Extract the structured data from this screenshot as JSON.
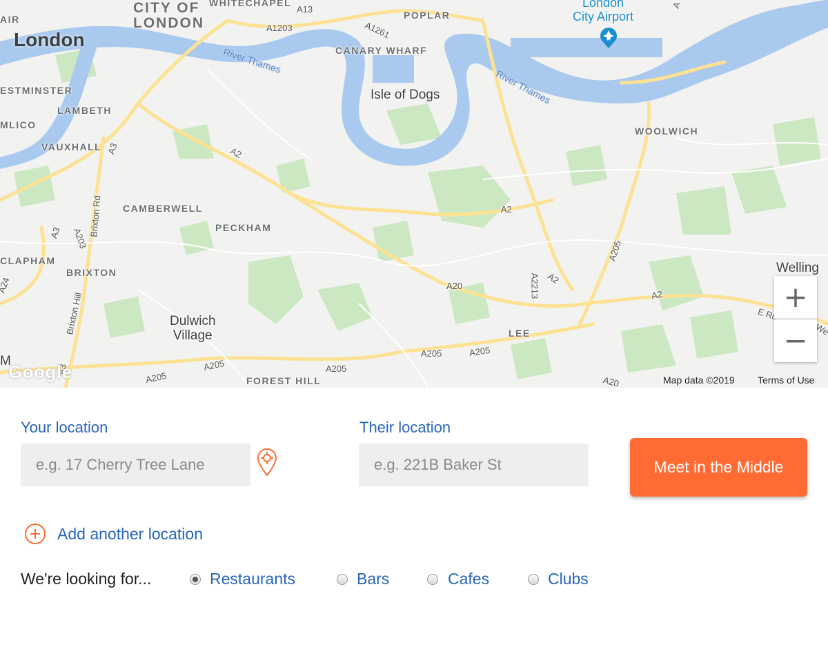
{
  "map": {
    "labels": {
      "city_of_london": "CITY OF\nLONDON",
      "london": "London",
      "whitechapel": "WHITECHAPEL",
      "poplar": "POPLAR",
      "canary_wharf": "CANARY WHARF",
      "isle_of_dogs": "Isle of Dogs",
      "airport": "London\nCity Airport",
      "westminster": "ESTMINSTER",
      "lambeth": "LAMBETH",
      "kennington": "MLICO",
      "vauxhall": "VAUXHALL",
      "air": "AIR",
      "camberwell": "CAMBERWELL",
      "peckham": "PECKHAM",
      "clapham": "CLAPHAM",
      "brixton": "BRIXTON",
      "dulwich": "Dulwich\nVillage",
      "lee": "LEE",
      "forest_hill": "FOREST HILL",
      "woolwich": "WOOLWICH",
      "welling": "Welling",
      "m": "M"
    },
    "roads": {
      "a13": "A13",
      "a1203": "A1203",
      "a1261": "A1261",
      "a2_west": "A2",
      "a3": "A3",
      "a3_south": "A3",
      "a203": "A203",
      "brixton_rd": "Brixton Rd",
      "brixton_hill": "Brixton Hill",
      "a2_center": "A2",
      "a20": "A20",
      "a2213": "A2213",
      "a2_south": "A2",
      "a2_east": "A2",
      "a205_east": "A205",
      "a205_s1": "A205",
      "a205_s2": "A205",
      "a205_s3": "A205",
      "a205_s4": "A205",
      "a205_s5": "A205",
      "a24": "A24",
      "a20_edge": "A20",
      "e_rd": "E Ro",
      "we": "We",
      "a_top": "A",
      "a3_bottom": "A3"
    },
    "rivers": {
      "thames_west": "River Thames",
      "thames_east": "River Thames"
    },
    "zoom_in": "+",
    "zoom_out": "−",
    "attribution": "Map data ©2019",
    "terms": "Terms of Use",
    "logo": "Google"
  },
  "form": {
    "your_location": {
      "label": "Your location",
      "placeholder": "e.g. 17 Cherry Tree Lane",
      "value": ""
    },
    "their_location": {
      "label": "Their location",
      "placeholder": "e.g. 221B Baker St",
      "value": ""
    },
    "submit_label": "Meet in the Middle",
    "add_location_label": "Add another location",
    "looking_for_label": "We're looking for...",
    "options": [
      {
        "label": "Restaurants",
        "checked": true
      },
      {
        "label": "Bars",
        "checked": false
      },
      {
        "label": "Cafes",
        "checked": false
      },
      {
        "label": "Clubs",
        "checked": false
      }
    ]
  },
  "colors": {
    "accent": "#ff6b33",
    "link_blue": "#2766b8",
    "water": "#aadaff",
    "park": "#c5e8c5",
    "road": "#fde293"
  },
  "icons": {
    "locate": "crosshair-pin-icon",
    "add": "plus-circle-icon",
    "airport": "airplane-icon"
  }
}
